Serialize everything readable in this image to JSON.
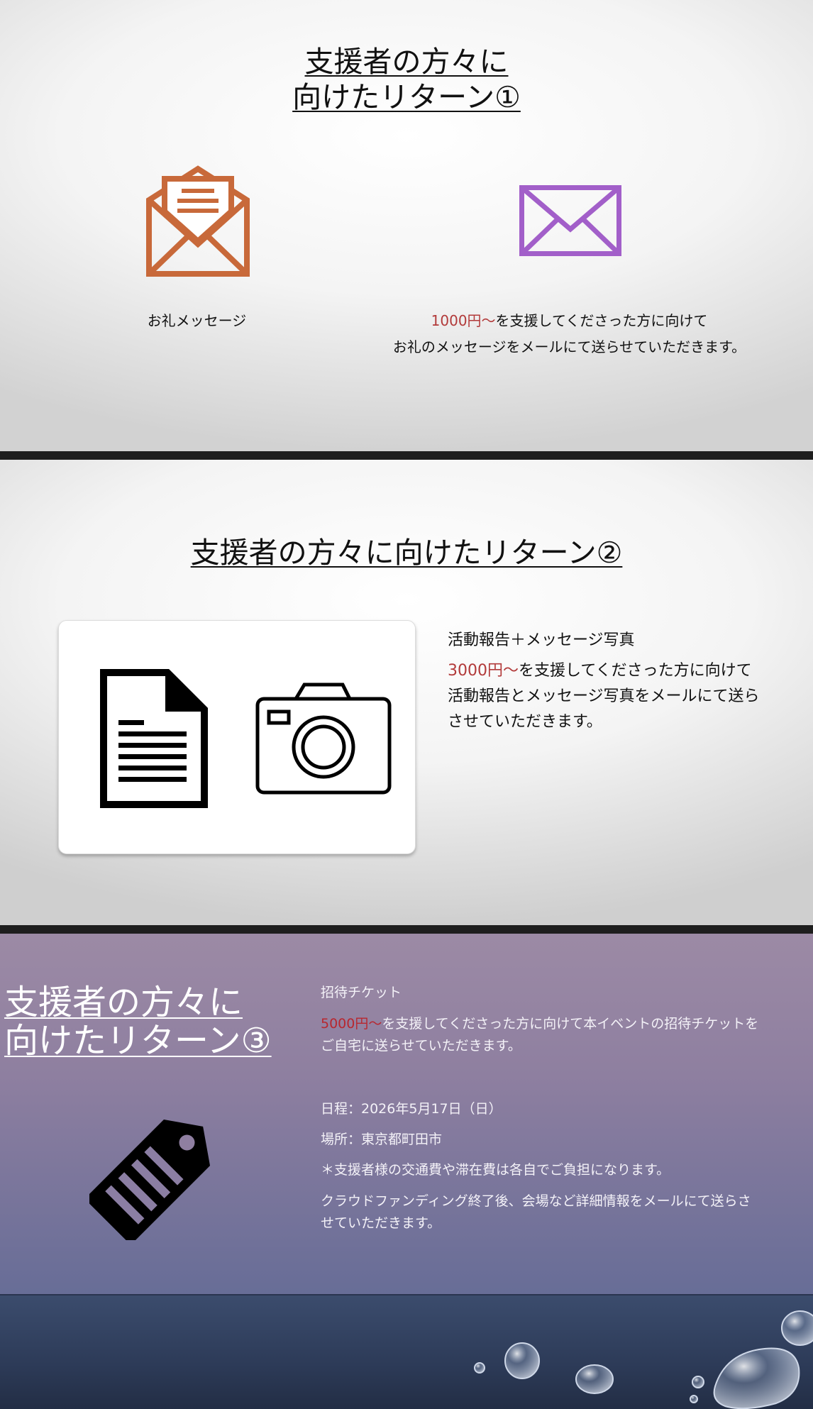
{
  "slides": [
    {
      "title_line1": "支援者の方々に",
      "title_line2": "向けたリターン①",
      "item_label": "お礼メッセージ",
      "amount": "1000円～",
      "desc_line1_rest": "を支援してくださった方に向けて",
      "desc_line2": "お礼のメッセージをメールにて送らせていただきます。",
      "icons": [
        "open-envelope-letter-icon",
        "envelope-icon"
      ],
      "colors": {
        "envelope_open": "#c8693a",
        "envelope": "#a25fc9",
        "amount": "#b23a3a"
      }
    },
    {
      "title": "支援者の方々に向けたリターン②",
      "heading": "活動報告＋メッセージ写真",
      "amount": "3000円～",
      "desc_rest": "を支援してくださった方に向けて活動報告とメッセージ写真をメールにて送らさせていただきます。",
      "icons": [
        "document-icon",
        "camera-icon"
      ]
    },
    {
      "title_line1": "支援者の方々に",
      "title_line2": "向けたリターン③",
      "heading": "招待チケット",
      "amount": "5000円～",
      "desc_rest": "を支援してくださった方に向けて本イベントの招待チケットをご自宅に送らせていただきます。",
      "date": "日程：2026年5月17日（日）",
      "place": "場所：東京都町田市",
      "note": "＊支援者様の交通費や滞在費は各自でご負担になります。",
      "info": "クラウドファンディング終了後、会場など詳細情報をメールにて送らさせていただきます。",
      "icons": [
        "ticket-tag-icon",
        "water-drops-decoration"
      ],
      "colors": {
        "amount": "#b8272f"
      }
    }
  ]
}
